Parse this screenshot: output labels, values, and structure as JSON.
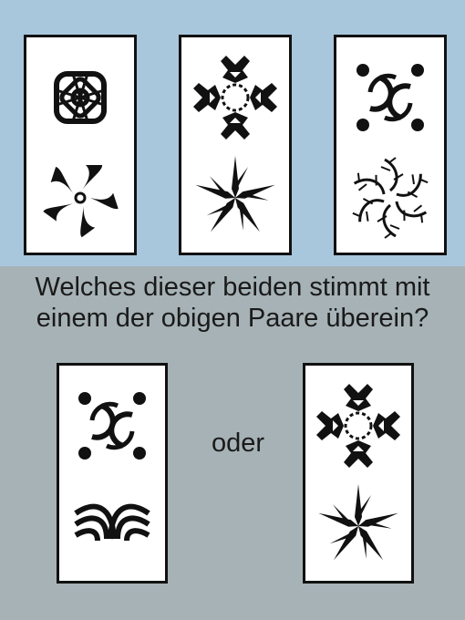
{
  "question": {
    "line1": "Welches dieser beiden stimmt mit",
    "line2": "einem der obigen Paare überein?"
  },
  "connector": "oder",
  "top_cards": [
    {
      "symbols": [
        "celtic-knot-square-icon",
        "triskele-swirl-icon"
      ]
    },
    {
      "symbols": [
        "tribal-cross-icon",
        "five-point-star-icon"
      ]
    },
    {
      "symbols": [
        "celtic-ring-dots-icon",
        "thorn-wreath-icon"
      ]
    }
  ],
  "option_cards": [
    {
      "symbols": [
        "celtic-ring-dots-icon",
        "arches-icon"
      ]
    },
    {
      "symbols": [
        "tribal-cross-icon",
        "five-point-star-icon"
      ]
    }
  ],
  "colors": {
    "top_background": "#a9c7dc",
    "bottom_background": "#a6b2b6",
    "ink": "#111111"
  }
}
